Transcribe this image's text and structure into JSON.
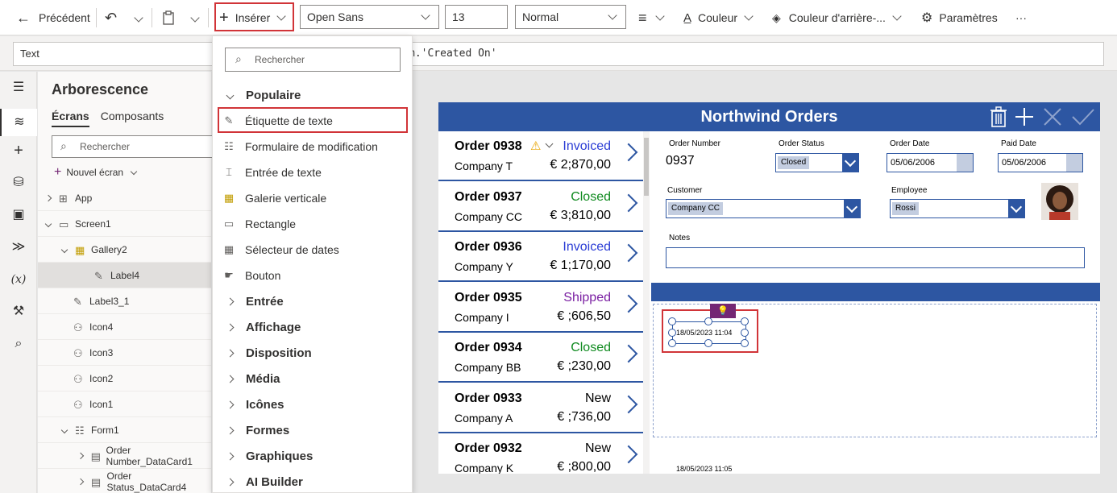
{
  "toolbar": {
    "back_label": "Précédent",
    "insert_label": "Insérer",
    "font": "Open Sans",
    "font_size": "13",
    "font_weight": "Normal",
    "color_label": "Couleur",
    "bg_color_label": "Couleur d'arrière-...",
    "settings_label": "Paramètres",
    "more_label": "···"
  },
  "formula_bar": {
    "property": "Text",
    "formula_tail": "m.'Created On'"
  },
  "tree": {
    "title": "Arborescence",
    "tabs": [
      "Écrans",
      "Composants"
    ],
    "search_placeholder": "Rechercher",
    "new_screen": "Nouvel écran",
    "items": [
      {
        "label": "App",
        "icon": "app-icon"
      },
      {
        "label": "Screen1",
        "icon": "screen-icon"
      },
      {
        "label": "Gallery2",
        "icon": "gallery-icon"
      },
      {
        "label": "Label4",
        "icon": "label-icon",
        "selected": true
      },
      {
        "label": "Label3_1",
        "icon": "label-icon"
      },
      {
        "label": "Icon4",
        "icon": "icon-control-icon"
      },
      {
        "label": "Icon3",
        "icon": "icon-control-icon"
      },
      {
        "label": "Icon2",
        "icon": "icon-control-icon"
      },
      {
        "label": "Icon1",
        "icon": "icon-control-icon"
      },
      {
        "label": "Form1",
        "icon": "form-icon"
      },
      {
        "label": "Order Number_DataCard1",
        "icon": "card-icon"
      },
      {
        "label": "Order Status_DataCard4",
        "icon": "card-icon"
      }
    ]
  },
  "insert_menu": {
    "search_placeholder": "Rechercher",
    "popular_label": "Populaire",
    "popular_items": [
      {
        "label": "Étiquette de texte",
        "icon": "text-label-icon"
      },
      {
        "label": "Formulaire de modification",
        "icon": "edit-form-icon"
      },
      {
        "label": "Entrée de texte",
        "icon": "text-input-icon"
      },
      {
        "label": "Galerie verticale",
        "icon": "vertical-gallery-icon"
      },
      {
        "label": "Rectangle",
        "icon": "rectangle-icon"
      },
      {
        "label": "Sélecteur de dates",
        "icon": "date-picker-icon"
      },
      {
        "label": "Bouton",
        "icon": "button-icon"
      }
    ],
    "categories": [
      "Entrée",
      "Affichage",
      "Disposition",
      "Média",
      "Icônes",
      "Formes",
      "Graphiques",
      "AI Builder"
    ]
  },
  "app": {
    "title": "Northwind Orders",
    "orders": [
      {
        "number": "Order 0938",
        "company": "Company T",
        "status": "Invoiced",
        "amount": "€ 2;870,00",
        "status_color": "#2b3dd5",
        "warning": true
      },
      {
        "number": "Order 0937",
        "company": "Company CC",
        "status": "Closed",
        "amount": "€ 3;810,00",
        "status_color": "#0f8a1f"
      },
      {
        "number": "Order 0936",
        "company": "Company Y",
        "status": "Invoiced",
        "amount": "€ 1;170,00",
        "status_color": "#2b3dd5"
      },
      {
        "number": "Order 0935",
        "company": "Company I",
        "status": "Shipped",
        "amount": "€ ;606,50",
        "status_color": "#7a1fa2"
      },
      {
        "number": "Order 0934",
        "company": "Company BB",
        "status": "Closed",
        "amount": "€ ;230,00",
        "status_color": "#0f8a1f"
      },
      {
        "number": "Order 0933",
        "company": "Company A",
        "status": "New",
        "amount": "€ ;736,00",
        "status_color": "#000000"
      },
      {
        "number": "Order 0932",
        "company": "Company K",
        "status": "New",
        "amount": "€ ;800,00",
        "status_color": "#000000"
      }
    ],
    "form": {
      "order_number_label": "Order Number",
      "order_number": "0937",
      "order_status_label": "Order Status",
      "order_status": "Closed",
      "order_date_label": "Order Date",
      "order_date": "05/06/2006",
      "paid_date_label": "Paid Date",
      "paid_date": "05/06/2006",
      "customer_label": "Customer",
      "customer": "Company CC",
      "employee_label": "Employee",
      "employee": "Rossi",
      "notes_label": "Notes",
      "notes": ""
    },
    "label_selected_text": "18/05/2023 11:04",
    "label_bottom_text": "18/05/2023 11:05"
  }
}
